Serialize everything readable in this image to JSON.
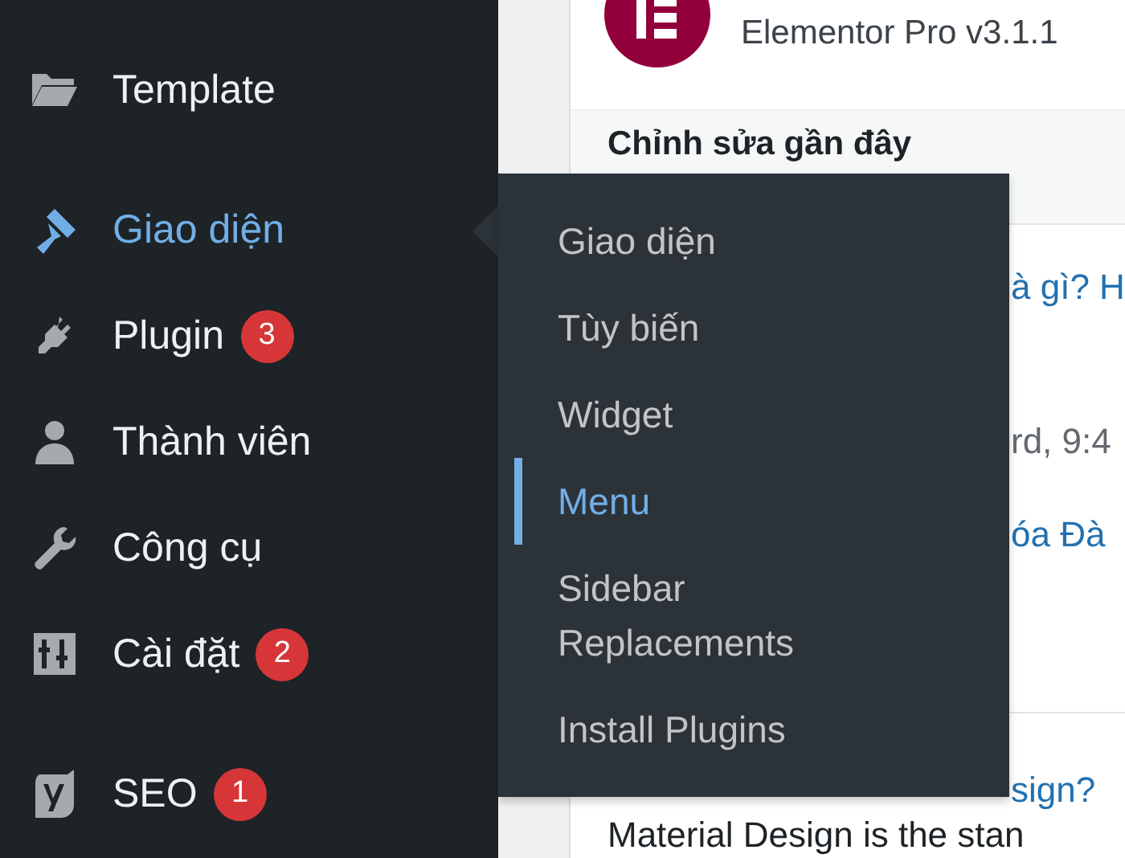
{
  "sidebar": {
    "items": [
      {
        "label": "Template",
        "current": false
      },
      {
        "label": "Giao diện",
        "current": true
      },
      {
        "label": "Plugin",
        "current": false,
        "badge": "3"
      },
      {
        "label": "Thành viên",
        "current": false
      },
      {
        "label": "Công cụ",
        "current": false
      },
      {
        "label": "Cài đặt",
        "current": false,
        "badge": "2"
      },
      {
        "label": "SEO",
        "current": false,
        "badge": "1"
      }
    ]
  },
  "submenu": {
    "items": [
      {
        "label": "Giao diện",
        "selected": false
      },
      {
        "label": "Tùy biến",
        "selected": false
      },
      {
        "label": "Widget",
        "selected": false
      },
      {
        "label": "Menu",
        "selected": true
      },
      {
        "label": "Sidebar Replacements",
        "selected": false
      },
      {
        "label": "Install Plugins",
        "selected": false
      }
    ]
  },
  "content": {
    "plugin_version": "Elementor Pro v3.1.1",
    "heading": "Chỉnh sửa gần đây",
    "fragments": [
      {
        "text": "à gì? H",
        "kind": "link"
      },
      {
        "text": "rd, 9:4",
        "kind": "meta"
      },
      {
        "text": "óa Đà",
        "kind": "link"
      }
    ],
    "post": {
      "title_fragment": "sign?",
      "excerpt": "Material Design is the stan"
    }
  }
}
